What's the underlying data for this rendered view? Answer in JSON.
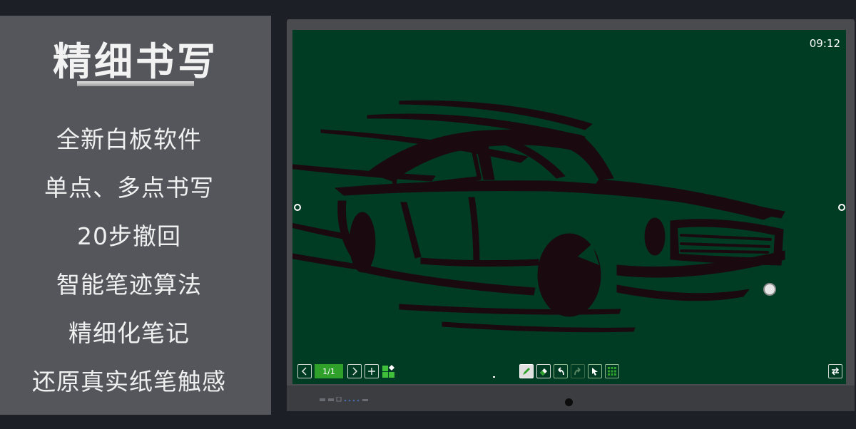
{
  "panel": {
    "title": "精细书写",
    "features": [
      "全新白板软件",
      "单点、多点书写",
      "20步撤回",
      "智能笔迹算法",
      "精细化笔记",
      "还原真实纸笔触感"
    ]
  },
  "board": {
    "clock": "09:12",
    "page_indicator": "1/1"
  },
  "colors": {
    "panel_bg": "#54565c",
    "board_bg": "#003c24",
    "accent": "#2fa12b",
    "drawing": "#1a0a10"
  },
  "toolbar": {
    "icons": [
      "chevron-left-icon",
      "chevron-right-icon",
      "add-page-icon",
      "page-grid-icon",
      "pen-icon",
      "eraser-icon",
      "undo-icon",
      "redo-icon",
      "select-icon",
      "more-tools-icon",
      "switch-icon"
    ]
  }
}
